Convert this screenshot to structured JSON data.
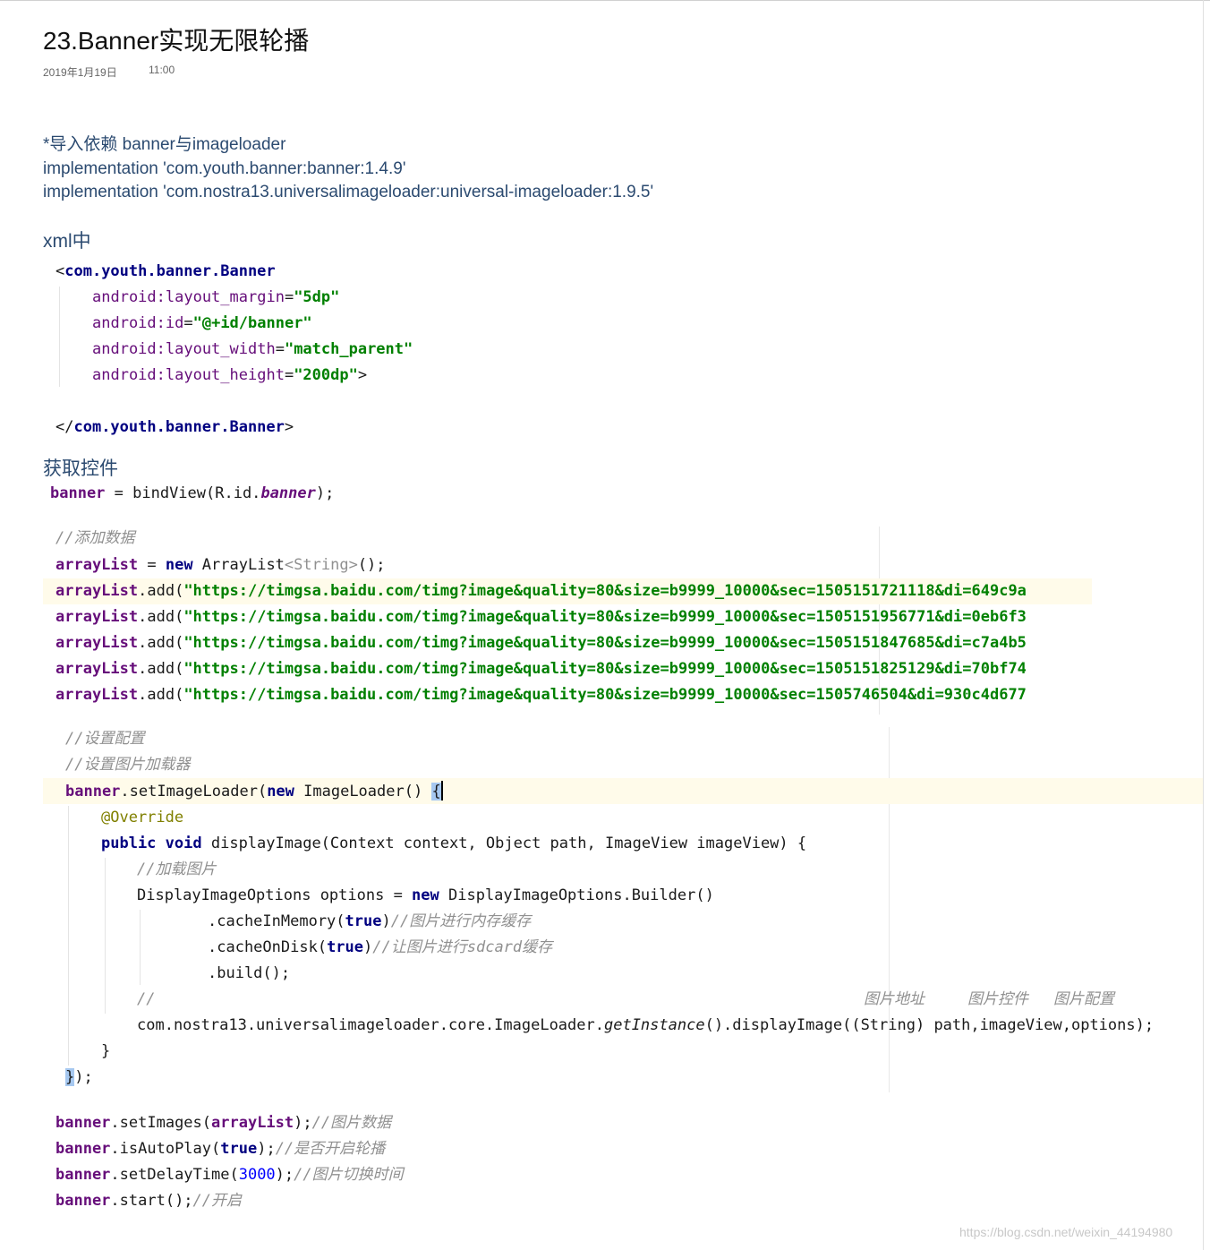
{
  "title": "23.Banner实现无限轮播",
  "date": "2019年1月19日",
  "time": "11:00",
  "deps": {
    "heading": "*导入依赖 banner与imageloader",
    "line1": "implementation 'com.youth.banner:banner:1.4.9'",
    "line2": "implementation 'com.nostra13.universalimageloader:universal-imageloader:1.9.5'"
  },
  "xml": {
    "heading": "xml中",
    "open_lt": "<",
    "tag": "com.youth.banner.Banner",
    "attrs": [
      {
        "name": "android:layout_margin",
        "eq": "=",
        "value": "\"5dp\"",
        "tail": ""
      },
      {
        "name": "android:id",
        "eq": "=",
        "value": "\"@+id/banner\"",
        "tail": ""
      },
      {
        "name": "android:layout_width",
        "eq": "=",
        "value": "\"match_parent\"",
        "tail": ""
      },
      {
        "name": "android:layout_height",
        "eq": "=",
        "value": "\"200dp\"",
        "tail": ">"
      }
    ],
    "close_lt": "</",
    "close_tag": "com.youth.banner.Banner",
    "close_gt": ">"
  },
  "get": {
    "heading": "获取控件",
    "field": "banner",
    "assign": " = bindView(R.id.",
    "id": "banner",
    "end": ");"
  },
  "data": {
    "comment": "//添加数据",
    "field": "arrayList",
    "eq": " = ",
    "kw_new": "new",
    "ctor": " ArrayList",
    "generic": "<String>",
    "ctor_end": "();",
    "add": ".add(",
    "urls": [
      "\"https://timgsa.baidu.com/timg?image&quality=80&size=b9999_10000&sec=1505151721118&di=649c9a",
      "\"https://timgsa.baidu.com/timg?image&quality=80&size=b9999_10000&sec=1505151956771&di=0eb6f3",
      "\"https://timgsa.baidu.com/timg?image&quality=80&size=b9999_10000&sec=1505151847685&di=c7a4b5",
      "\"https://timgsa.baidu.com/timg?image&quality=80&size=b9999_10000&sec=1505151825129&di=70bf74",
      "\"https://timgsa.baidu.com/timg?image&quality=80&size=b9999_10000&sec=1505746504&di=930c4d677"
    ]
  },
  "loader": {
    "c1": "//设置配置",
    "c2": "//设置图片加载器",
    "field": "banner",
    "method": ".setImageLoader(",
    "kw_new": "new",
    "cls": " ImageLoader() ",
    "brace_open": "{",
    "anno": "@Override",
    "kw_public": "public",
    "kw_void": "void",
    "sig": " displayImage(Context context, Object path, ImageView imageView) {",
    "c3": "//加载图片",
    "opts_start": "DisplayImageOptions options = ",
    "opts_new": "new",
    "opts_end": " DisplayImageOptions.Builder()",
    "mem_call": ".cacheInMemory(",
    "kw_true": "true",
    "mem_end": ")",
    "mem_cmt": "//图片进行内存缓存",
    "disk_call": ".cacheOnDisk(",
    "disk_end": ")",
    "disk_cmt": "//让图片进行sdcard缓存",
    "build": ".build();",
    "slash": "//",
    "lbl_addr": "图片地址",
    "lbl_ctrl": "图片控件",
    "lbl_cfg": "图片配置",
    "call_pre": "com.nostra13.universalimageloader.core.ImageLoader.",
    "call_get": "getInstance",
    "call_post": "().displayImage((String) path,imageView,options);",
    "inner_close": "}",
    "close_brace": "}",
    "close_end": ");"
  },
  "tail": {
    "field": "banner",
    "l1_call": ".setImages(",
    "l1_arg": "arrayList",
    "l1_end": ");",
    "l1_cmt": "//图片数据",
    "l2_call": ".isAutoPlay(",
    "l2_arg": "true",
    "l2_end": ");",
    "l2_cmt": "//是否开启轮播",
    "l3_call": ".setDelayTime(",
    "l3_arg": "3000",
    "l3_end": ");",
    "l3_cmt": "//图片切换时间",
    "l4_call": ".start();",
    "l4_cmt": "//开启"
  },
  "watermark": "https://blog.csdn.net/weixin_44194980"
}
